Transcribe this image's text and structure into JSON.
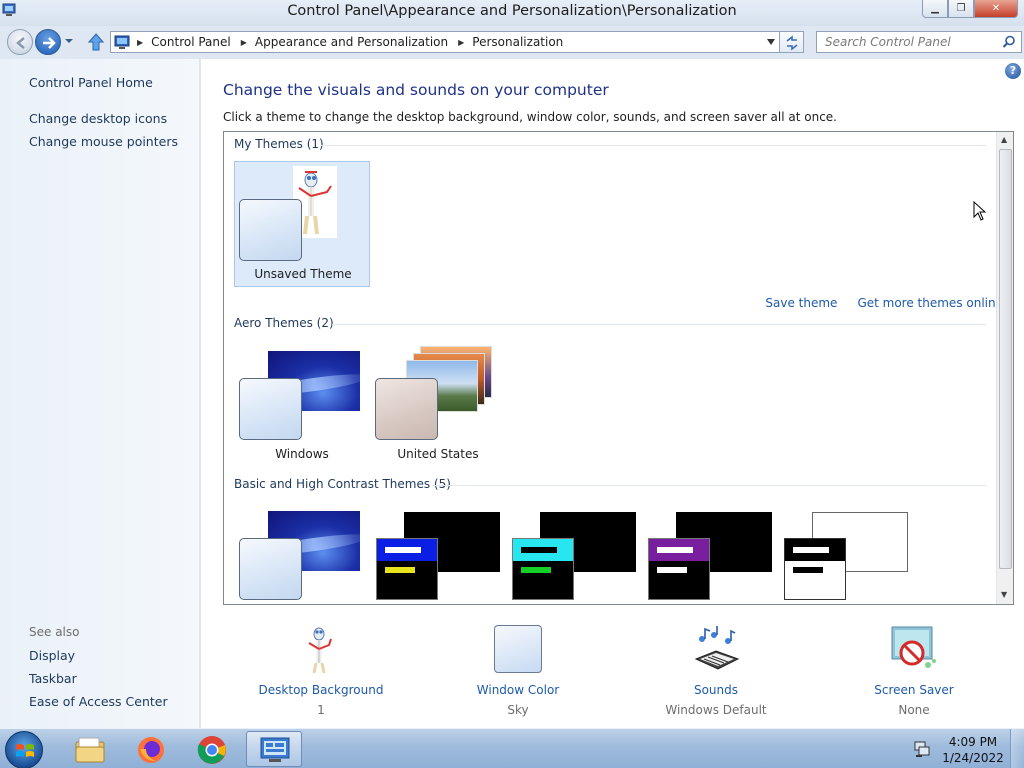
{
  "window": {
    "title": "Control Panel\\Appearance and Personalization\\Personalization",
    "buttons": [
      "minimize",
      "maximize",
      "close"
    ]
  },
  "navbar": {
    "breadcrumbs": [
      "Control Panel",
      "Appearance and Personalization",
      "Personalization"
    ],
    "search_placeholder": "Search Control Panel"
  },
  "sidebar": {
    "items": [
      {
        "label": "Control Panel Home"
      },
      {
        "label": "Change desktop icons"
      },
      {
        "label": "Change mouse pointers"
      }
    ],
    "see_also_heading": "See also",
    "see_also": [
      {
        "label": "Display"
      },
      {
        "label": "Taskbar"
      },
      {
        "label": "Ease of Access Center"
      }
    ]
  },
  "main": {
    "title": "Change the visuals and sounds on your computer",
    "description": "Click a theme to change the desktop background, window color, sounds, and screen saver all at once.",
    "groups": {
      "my_themes": {
        "label": "My Themes (1)",
        "themes": [
          {
            "label": "Unsaved Theme",
            "selected": true
          }
        ]
      },
      "aero": {
        "label": "Aero Themes (2)",
        "themes": [
          {
            "label": "Windows"
          },
          {
            "label": "United States"
          }
        ]
      },
      "basic": {
        "label": "Basic and High Contrast Themes (5)"
      }
    },
    "links": {
      "save_theme": "Save theme",
      "get_more": "Get more themes online"
    },
    "settings": [
      {
        "label": "Desktop Background",
        "value": "1"
      },
      {
        "label": "Window Color",
        "value": "Sky"
      },
      {
        "label": "Sounds",
        "value": "Windows Default"
      },
      {
        "label": "Screen Saver",
        "value": "None"
      }
    ]
  },
  "taskbar": {
    "apps": [
      "windows-explorer-icon",
      "firefox-icon",
      "chrome-icon",
      "control-panel-icon"
    ],
    "clock": {
      "time": "4:09 PM",
      "date": "1/24/2022"
    }
  },
  "colors": {
    "link": "#1e5aa8",
    "title": "#1e3287",
    "selection": "#dceaf9"
  }
}
